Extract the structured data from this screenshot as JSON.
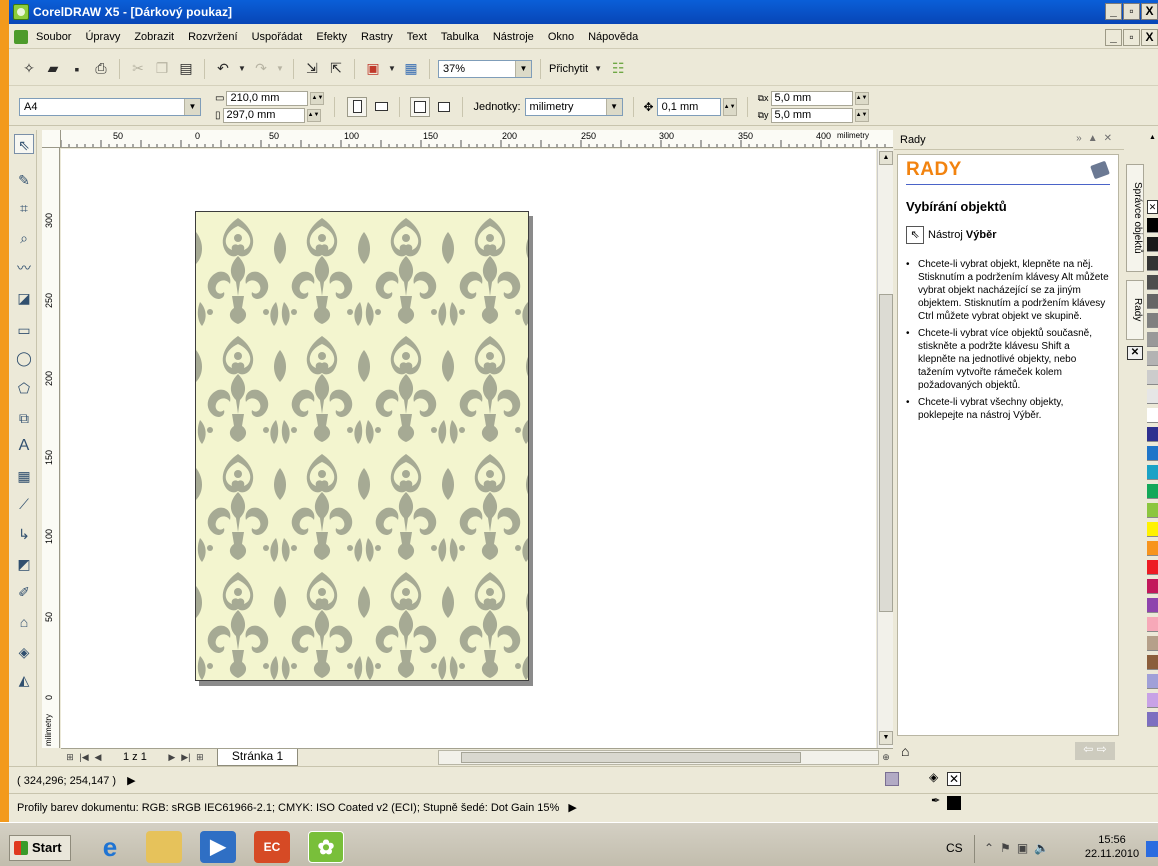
{
  "window": {
    "title": "CorelDRAW X5 - [Dárkový poukaz]",
    "minimize": "_",
    "maximize": "е",
    "close": "X"
  },
  "menu": [
    "Soubor",
    "Úpravy",
    "Zobrazit",
    "Rozvržení",
    "Uspořádat",
    "Efekty",
    "Rastry",
    "Text",
    "Tabulka",
    "Nástroje",
    "Okno",
    "Nápověda"
  ],
  "toolbar": {
    "zoom": "37%",
    "snap_label": "Přichytit"
  },
  "property_bar": {
    "page_size": "A4",
    "width": "210,0 mm",
    "height": "297,0 mm",
    "units_label": "Jednotky:",
    "units_value": "milimetry",
    "nudge": "0,1 mm",
    "dup_x": "5,0 mm",
    "dup_y": "5,0 mm"
  },
  "ruler": {
    "h_labels": [
      "50",
      "0",
      "50",
      "100",
      "150",
      "200",
      "250",
      "300",
      "350",
      "400"
    ],
    "h_unit": "milimetry",
    "v_labels": [
      "300",
      "250",
      "200",
      "150",
      "100",
      "50",
      "0"
    ],
    "v_unit": "milimetry"
  },
  "page_nav": {
    "counter": "1 z 1",
    "tab": "Stránka 1"
  },
  "docker": {
    "header": "Rady",
    "title": "RADY",
    "tip_title": "Vybírání objektů",
    "tool_prefix": "Nástroj",
    "tool_name": "Výběr",
    "tips": [
      "Chcete-li vybrat objekt, klepněte na něj. Stisknutím a podržením klávesy Alt můžete vybrat objekt nacházející se za jiným objektem. Stisknutím a podržením klávesy Ctrl můžete vybrat objekt ve skupině.",
      "Chcete-li vybrat více objektů současně, stiskněte a podržte klávesu Shift a klepněte na jednotlivé objekty, nebo tažením vytvořte rámeček kolem požadovaných objektů.",
      "Chcete-li vybrat všechny objekty, poklepejte na nástroj Výběr."
    ],
    "side_tab_1": "Správce objektů",
    "side_tab_2": "Rady"
  },
  "status": {
    "coords": "( 324,296; 254,147 )",
    "color_profiles": "Profily barev dokumentu: RGB: sRGB IEC61966-2.1; CMYK: ISO Coated v2 (ECI); Stupně šedé: Dot Gain 15%"
  },
  "taskbar": {
    "start": "Start",
    "lang": "CS",
    "time": "15:56",
    "date": "22.11.2010"
  },
  "colors": {
    "page_bg": "#f3f5cf",
    "pattern": "#a6aa94",
    "accent": "#f2830f"
  }
}
